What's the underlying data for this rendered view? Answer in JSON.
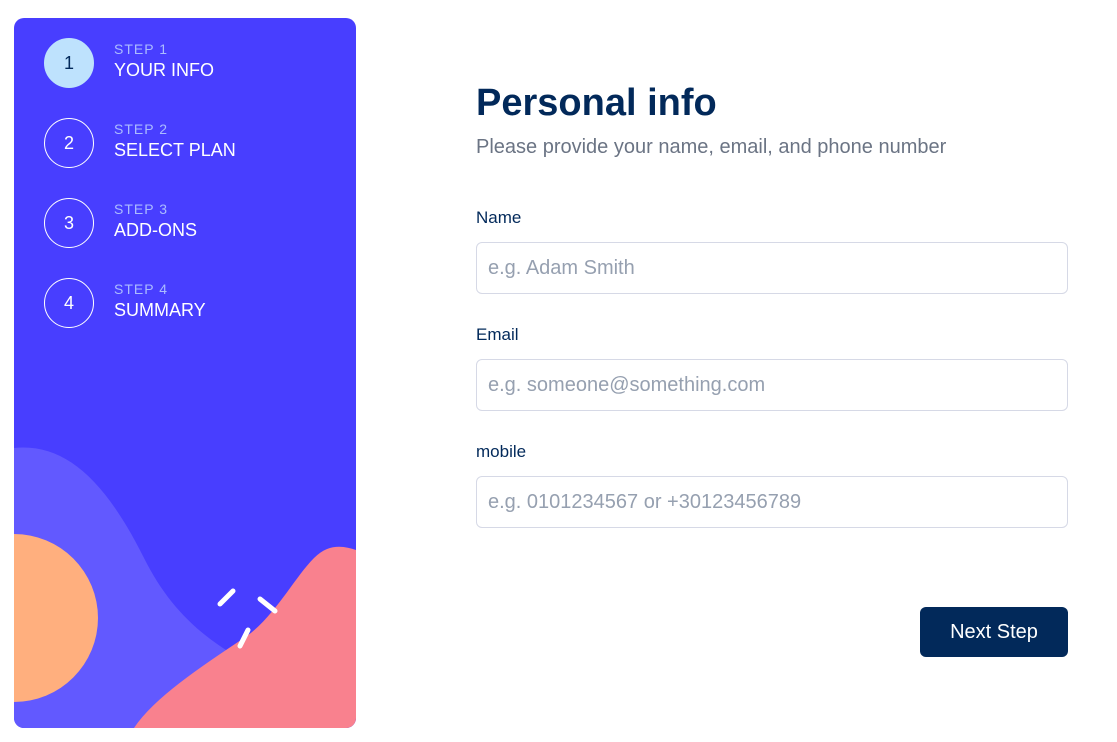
{
  "colors": {
    "sidebar_bg": "#483eff",
    "active_step": "#bee2fd",
    "primary_text": "#02295a",
    "muted_text": "#6b7484",
    "button_bg": "#02295a",
    "blob_coral": "#f9818e",
    "blob_orange": "#ffaf7e",
    "blob_violet": "#6259ff"
  },
  "sidebar": {
    "steps": [
      {
        "label": "STEP 1",
        "title": "YOUR INFO",
        "number": "1",
        "active": true
      },
      {
        "label": "STEP 2",
        "title": "SELECT PLAN",
        "number": "2",
        "active": false
      },
      {
        "label": "STEP 3",
        "title": "ADD-ONS",
        "number": "3",
        "active": false
      },
      {
        "label": "STEP 4",
        "title": "SUMMARY",
        "number": "4",
        "active": false
      }
    ]
  },
  "main": {
    "title": "Personal info",
    "subtitle": "Please provide your name, email, and phone number",
    "fields": {
      "name": {
        "label": "Name",
        "placeholder": "e.g. Adam Smith",
        "value": ""
      },
      "email": {
        "label": "Email",
        "placeholder": "e.g. someone@something.com",
        "value": ""
      },
      "mobile": {
        "label": "mobile",
        "placeholder": "e.g. 0101234567 or +30123456789",
        "value": ""
      }
    },
    "next_label": "Next Step"
  }
}
